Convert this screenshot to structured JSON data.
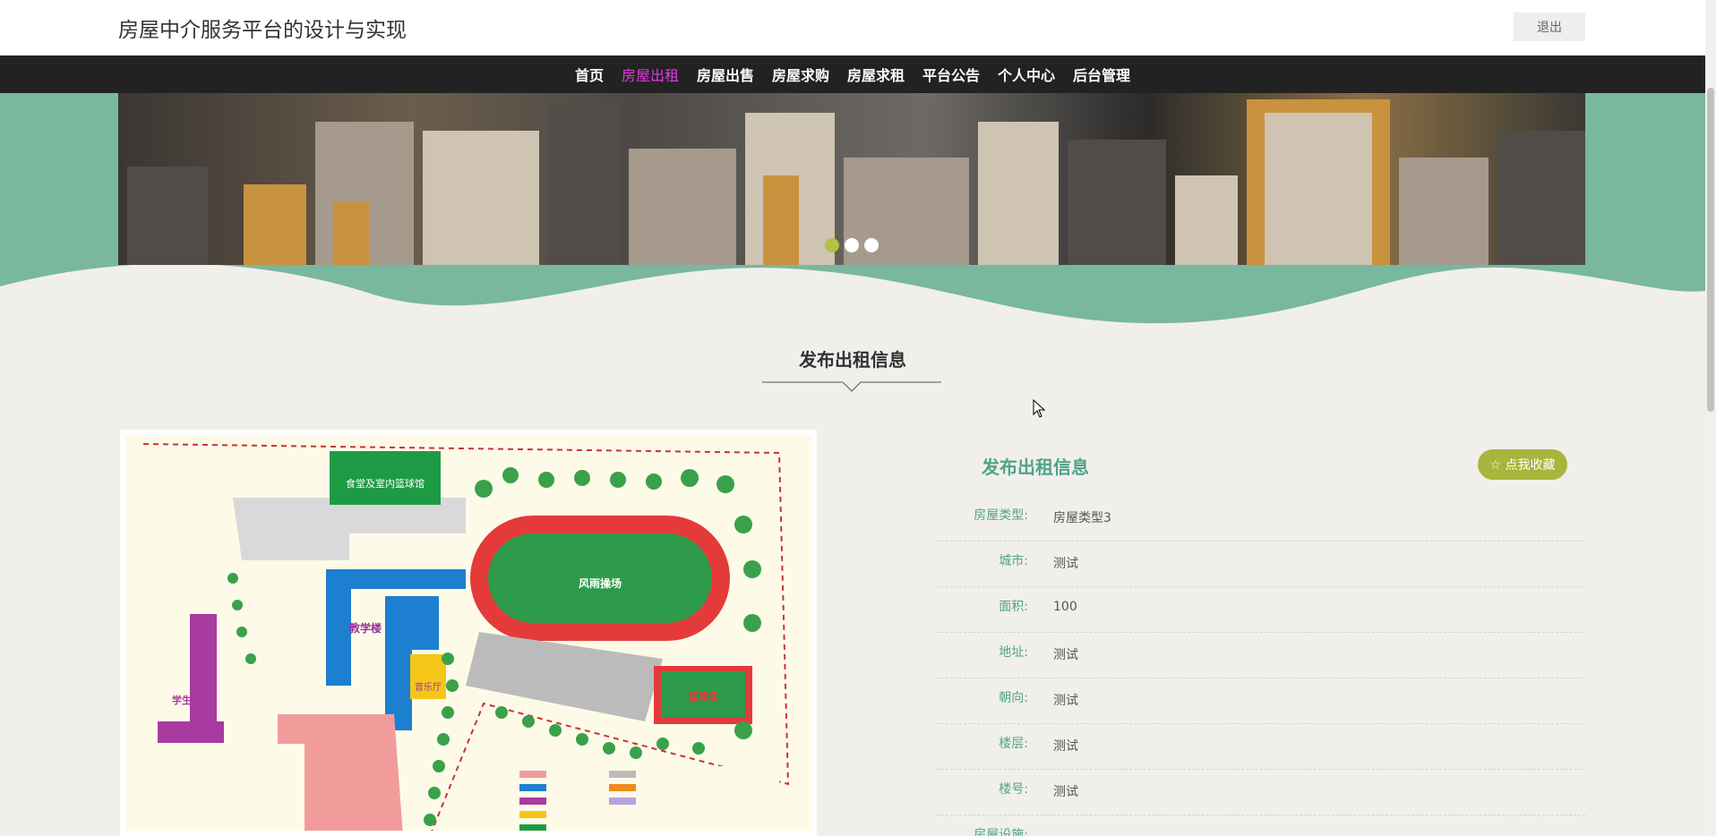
{
  "header": {
    "title": "房屋中介服务平台的设计与实现",
    "logout_label": "退出"
  },
  "nav": {
    "items": [
      {
        "label": "首页"
      },
      {
        "label": "房屋出租"
      },
      {
        "label": "房屋出售"
      },
      {
        "label": "房屋求购"
      },
      {
        "label": "房屋求租"
      },
      {
        "label": "平台公告"
      },
      {
        "label": "个人中心"
      },
      {
        "label": "后台管理"
      }
    ],
    "active_index": 1,
    "active_color": "#e238e6"
  },
  "carousel": {
    "slide_count": 3,
    "active_index": 0,
    "active_color": "#b2c343"
  },
  "section": {
    "title": "发布出租信息"
  },
  "detail": {
    "title": "发布出租信息",
    "favorite_label": "点我收藏",
    "fields": [
      {
        "label": "房屋类型:",
        "value": "房屋类型3"
      },
      {
        "label": "城市:",
        "value": "测试"
      },
      {
        "label": "面积:",
        "value": "100"
      },
      {
        "label": "地址:",
        "value": "测试"
      },
      {
        "label": "朝向:",
        "value": "测试"
      },
      {
        "label": "楼层:",
        "value": "测试"
      },
      {
        "label": "楼号:",
        "value": "测试"
      },
      {
        "label": "房屋设施:",
        "value": ""
      }
    ]
  },
  "map": {
    "canteen": "食堂及室内篮球馆",
    "teaching": "教学楼",
    "dorm": "学生宿舍",
    "field": "风雨操场",
    "music": "音乐厅",
    "court": "篮球场"
  },
  "colors": {
    "brand_green": "#4fa389",
    "band_green": "#79b79e",
    "fav_button": "#a9b53d",
    "nav_bg": "#222222"
  }
}
